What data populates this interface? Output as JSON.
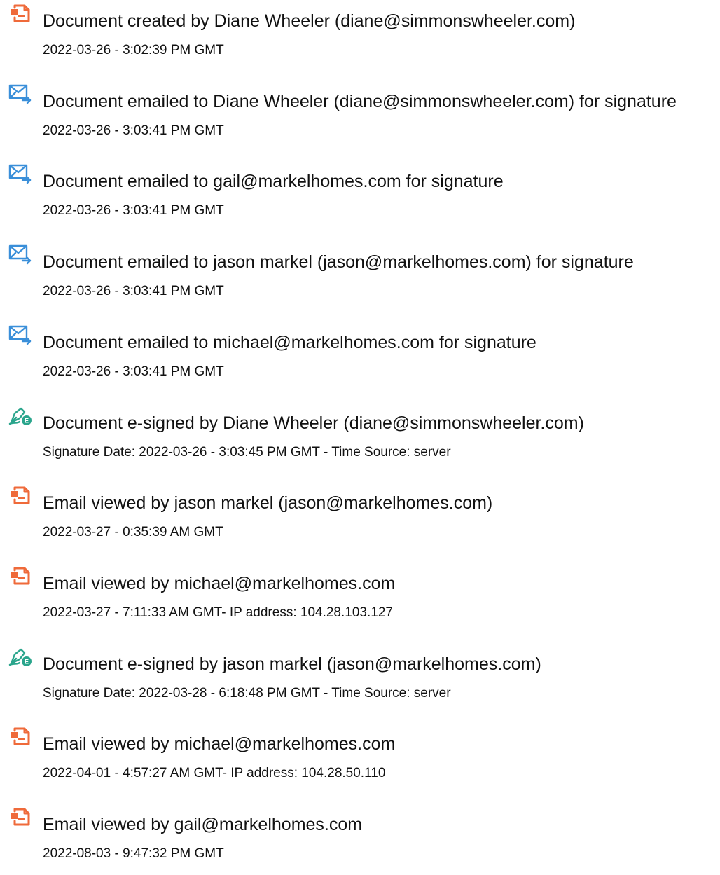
{
  "colors": {
    "doc_icon": "#ef6a3a",
    "email_icon": "#3a8fd9",
    "sign_icon": "#2aa58c",
    "text": "#111111",
    "background": "#ffffff"
  },
  "events": [
    {
      "icon": "document-icon",
      "title": "Document created by Diane Wheeler (diane@simmonswheeler.com)",
      "detail": "2022-03-26 - 3:02:39 PM GMT"
    },
    {
      "icon": "email-sent-icon",
      "title": "Document emailed to Diane Wheeler (diane@simmonswheeler.com) for signature",
      "detail": "2022-03-26 - 3:03:41 PM GMT"
    },
    {
      "icon": "email-sent-icon",
      "title": "Document emailed to gail@markelhomes.com for signature",
      "detail": "2022-03-26 - 3:03:41 PM GMT"
    },
    {
      "icon": "email-sent-icon",
      "title": "Document emailed to jason markel (jason@markelhomes.com) for signature",
      "detail": "2022-03-26 - 3:03:41 PM GMT"
    },
    {
      "icon": "email-sent-icon",
      "title": "Document emailed to michael@markelhomes.com for signature",
      "detail": "2022-03-26 - 3:03:41 PM GMT"
    },
    {
      "icon": "e-sign-pen-icon",
      "title": "Document e-signed by Diane Wheeler (diane@simmonswheeler.com)",
      "detail": "Signature Date: 2022-03-26 - 3:03:45 PM GMT - Time Source: server"
    },
    {
      "icon": "document-icon",
      "title": "Email viewed by jason markel (jason@markelhomes.com)",
      "detail": "2022-03-27 - 0:35:39 AM GMT"
    },
    {
      "icon": "document-icon",
      "title": "Email viewed by michael@markelhomes.com",
      "detail": "2022-03-27 - 7:11:33 AM GMT- IP address: 104.28.103.127"
    },
    {
      "icon": "e-sign-pen-icon",
      "title": "Document e-signed by jason markel (jason@markelhomes.com)",
      "detail": "Signature Date: 2022-03-28 - 6:18:48 PM GMT - Time Source: server"
    },
    {
      "icon": "document-icon",
      "title": "Email viewed by michael@markelhomes.com",
      "detail": "2022-04-01 - 4:57:27 AM GMT- IP address: 104.28.50.110"
    },
    {
      "icon": "document-icon",
      "title": "Email viewed by gail@markelhomes.com",
      "detail": "2022-08-03 - 9:47:32 PM GMT"
    }
  ]
}
